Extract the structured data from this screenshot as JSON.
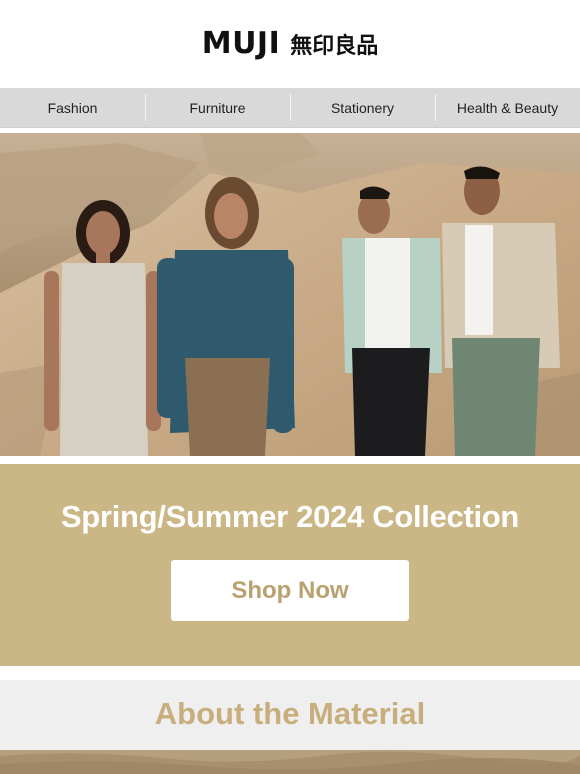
{
  "header": {
    "logo_latin": "MUJI",
    "logo_kanji": "無印良品"
  },
  "nav": {
    "items": [
      {
        "label": "Fashion"
      },
      {
        "label": "Furniture"
      },
      {
        "label": "Stationery"
      },
      {
        "label": "Health & Beauty"
      }
    ]
  },
  "promo": {
    "title": "Spring/Summer 2024 Collection",
    "button_label": "Shop Now",
    "background": "#cbb685",
    "button_text_color": "#b9a170"
  },
  "about": {
    "title": "About the Material",
    "title_color": "#c8ae7c"
  }
}
